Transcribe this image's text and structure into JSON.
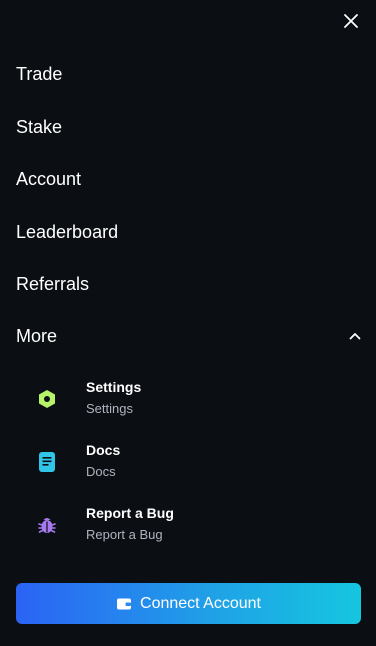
{
  "menu": {
    "items": [
      {
        "label": "Trade"
      },
      {
        "label": "Stake"
      },
      {
        "label": "Account"
      },
      {
        "label": "Leaderboard"
      },
      {
        "label": "Referrals"
      }
    ],
    "more": {
      "label": "More",
      "expanded": true,
      "items": [
        {
          "title": "Settings",
          "description": "Settings",
          "icon": "settings-icon",
          "color": "#b6f26a"
        },
        {
          "title": "Docs",
          "description": "Docs",
          "icon": "docs-icon",
          "color": "#31c6e8"
        },
        {
          "title": "Report a Bug",
          "description": "Report a Bug",
          "icon": "bug-icon",
          "color": "#a779f0"
        }
      ]
    }
  },
  "connect_button": {
    "label": "Connect Account",
    "icon": "wallet-icon"
  },
  "colors": {
    "background": "#0b0e13",
    "button_gradient_start": "#2b63f5",
    "button_gradient_end": "#15c6df"
  }
}
